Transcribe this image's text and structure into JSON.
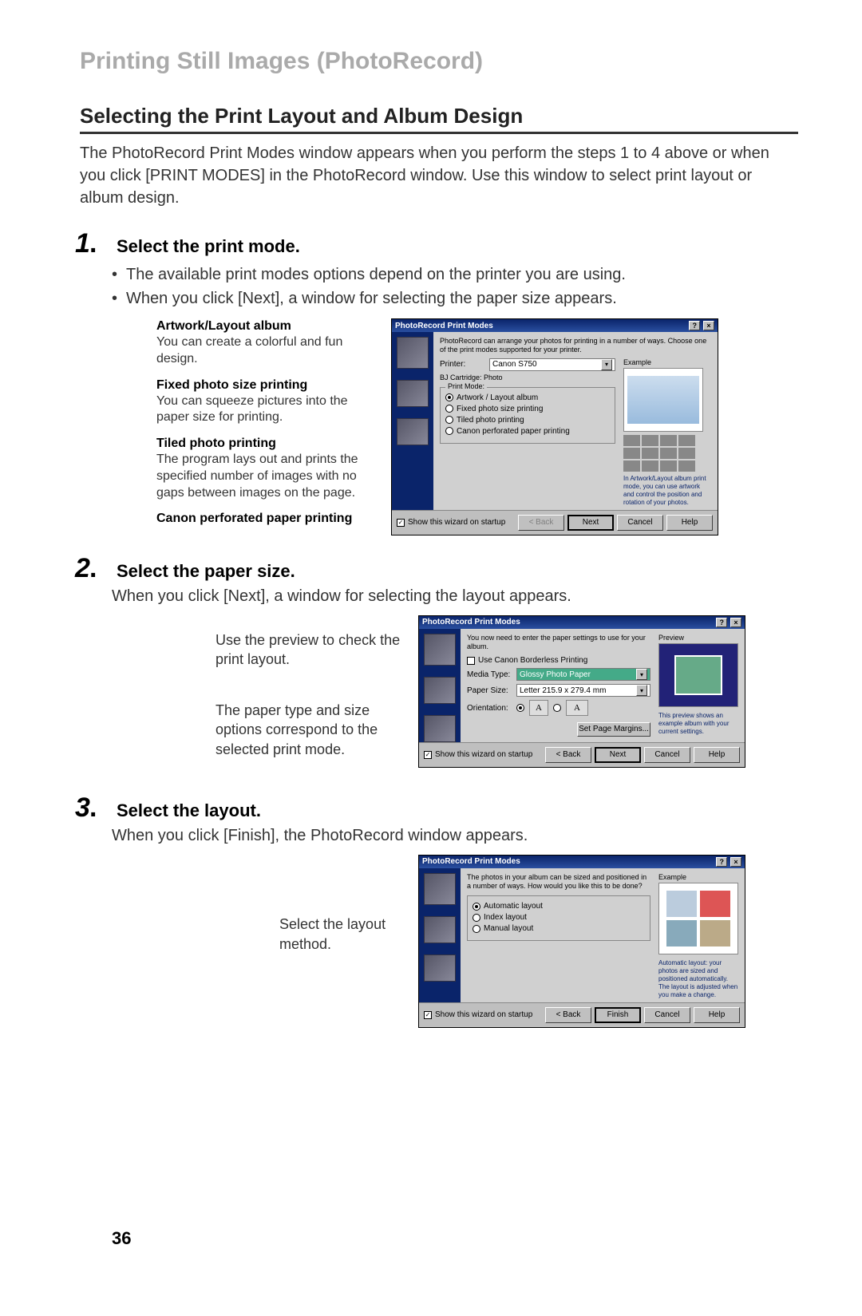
{
  "chapter": "Printing Still Images (PhotoRecord)",
  "section_title": "Selecting the Print Layout and Album Design",
  "intro": "The PhotoRecord Print Modes window appears when you perform the steps 1 to 4 above or when you click [PRINT MODES] in the PhotoRecord window. Use this window to select print layout or album design.",
  "page_number": "36",
  "steps": [
    {
      "num": "1",
      "title": "Select the print mode.",
      "bullets": [
        "The available print modes options depend on the printer you are using.",
        "When you click [Next], a window for selecting the paper size appears."
      ],
      "callouts": [
        {
          "title": "Artwork/Layout album",
          "body": "You can create a colorful and fun design."
        },
        {
          "title": "Fixed photo size printing",
          "body": "You can squeeze pictures into the paper size for printing."
        },
        {
          "title": "Tiled photo printing",
          "body": "The program lays out and prints the specified number of images with no gaps between images on the page."
        },
        {
          "title": "Canon perforated paper printing",
          "body": ""
        }
      ]
    },
    {
      "num": "2",
      "title": "Select the paper size.",
      "body": "When you click [Next], a window for selecting the layout appears.",
      "leaders": [
        "Use the preview to check the print layout.",
        "The paper type and size options correspond to the selected print mode."
      ]
    },
    {
      "num": "3",
      "title": "Select the layout.",
      "body": "When you click [Finish], the PhotoRecord window appears.",
      "leaders": [
        "Select the layout method."
      ]
    }
  ],
  "dialog1": {
    "title": "PhotoRecord Print Modes",
    "desc": "PhotoRecord can arrange your photos for printing in a number of ways. Choose one of the print modes supported for your printer.",
    "printer_label": "Printer:",
    "printer_value": "Canon S750",
    "cartridge": "BJ Cartridge:   Photo",
    "group_label": "Print Mode:",
    "options": [
      "Artwork / Layout album",
      "Fixed photo size printing",
      "Tiled photo printing",
      "Canon perforated paper printing"
    ],
    "example_label": "Example",
    "info_text": "In Artwork/Layout album print mode, you can use artwork and control the position and rotation of your photos.",
    "show_label": "Show this wizard on startup",
    "buttons": {
      "back": "< Back",
      "next": "Next",
      "cancel": "Cancel",
      "help": "Help"
    }
  },
  "dialog2": {
    "title": "PhotoRecord Print Modes",
    "desc": "You now need to enter the paper settings to use for your album.",
    "borderless": "Use Canon Borderless Printing",
    "media_label": "Media Type:",
    "media_value": "Glossy Photo Paper",
    "size_label": "Paper Size:",
    "size_value": "Letter 215.9 x 279.4 mm",
    "orient_label": "Orientation:",
    "margins_btn": "Set Page Margins...",
    "preview_label": "Preview",
    "info_text": "This preview shows an example album with your current settings.",
    "show_label": "Show this wizard on startup",
    "buttons": {
      "back": "< Back",
      "next": "Next",
      "cancel": "Cancel",
      "help": "Help"
    }
  },
  "dialog3": {
    "title": "PhotoRecord Print Modes",
    "desc": "The photos in your album can be sized and positioned in a number of ways. How would you like this to be done?",
    "options": [
      "Automatic layout",
      "Index layout",
      "Manual layout"
    ],
    "example_label": "Example",
    "info_text": "Automatic layout: your photos are sized and positioned automatically. The layout is adjusted when you make a change.",
    "show_label": "Show this wizard on startup",
    "buttons": {
      "back": "< Back",
      "finish": "Finish",
      "cancel": "Cancel",
      "help": "Help"
    }
  }
}
